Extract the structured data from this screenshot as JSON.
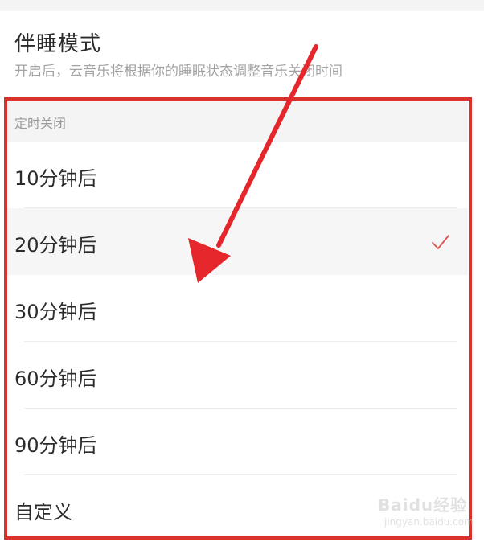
{
  "sleep_mode": {
    "title": "伴睡模式",
    "description": "开启后，云音乐将根据你的睡眠状态调整音乐关闭时间"
  },
  "timer": {
    "header": "定时关闭",
    "options": [
      {
        "label": "10分钟后",
        "selected": false
      },
      {
        "label": "20分钟后",
        "selected": true
      },
      {
        "label": "30分钟后",
        "selected": false
      },
      {
        "label": "60分钟后",
        "selected": false
      },
      {
        "label": "90分钟后",
        "selected": false
      },
      {
        "label": "自定义",
        "selected": false
      }
    ],
    "check_icon": "checkmark-icon"
  },
  "annotation": {
    "frame_color": "#d9322b",
    "arrow_color": "#e5262b",
    "arrow_icon": "arrow-down-left-icon"
  },
  "colors": {
    "check": "#d9534f",
    "text_primary": "#2b2b2b",
    "text_secondary": "#a3a3a3",
    "header_bg": "#f4f4f4"
  },
  "watermark": {
    "brand": "Baidu经验",
    "url": "jingyan.baidu.com"
  }
}
